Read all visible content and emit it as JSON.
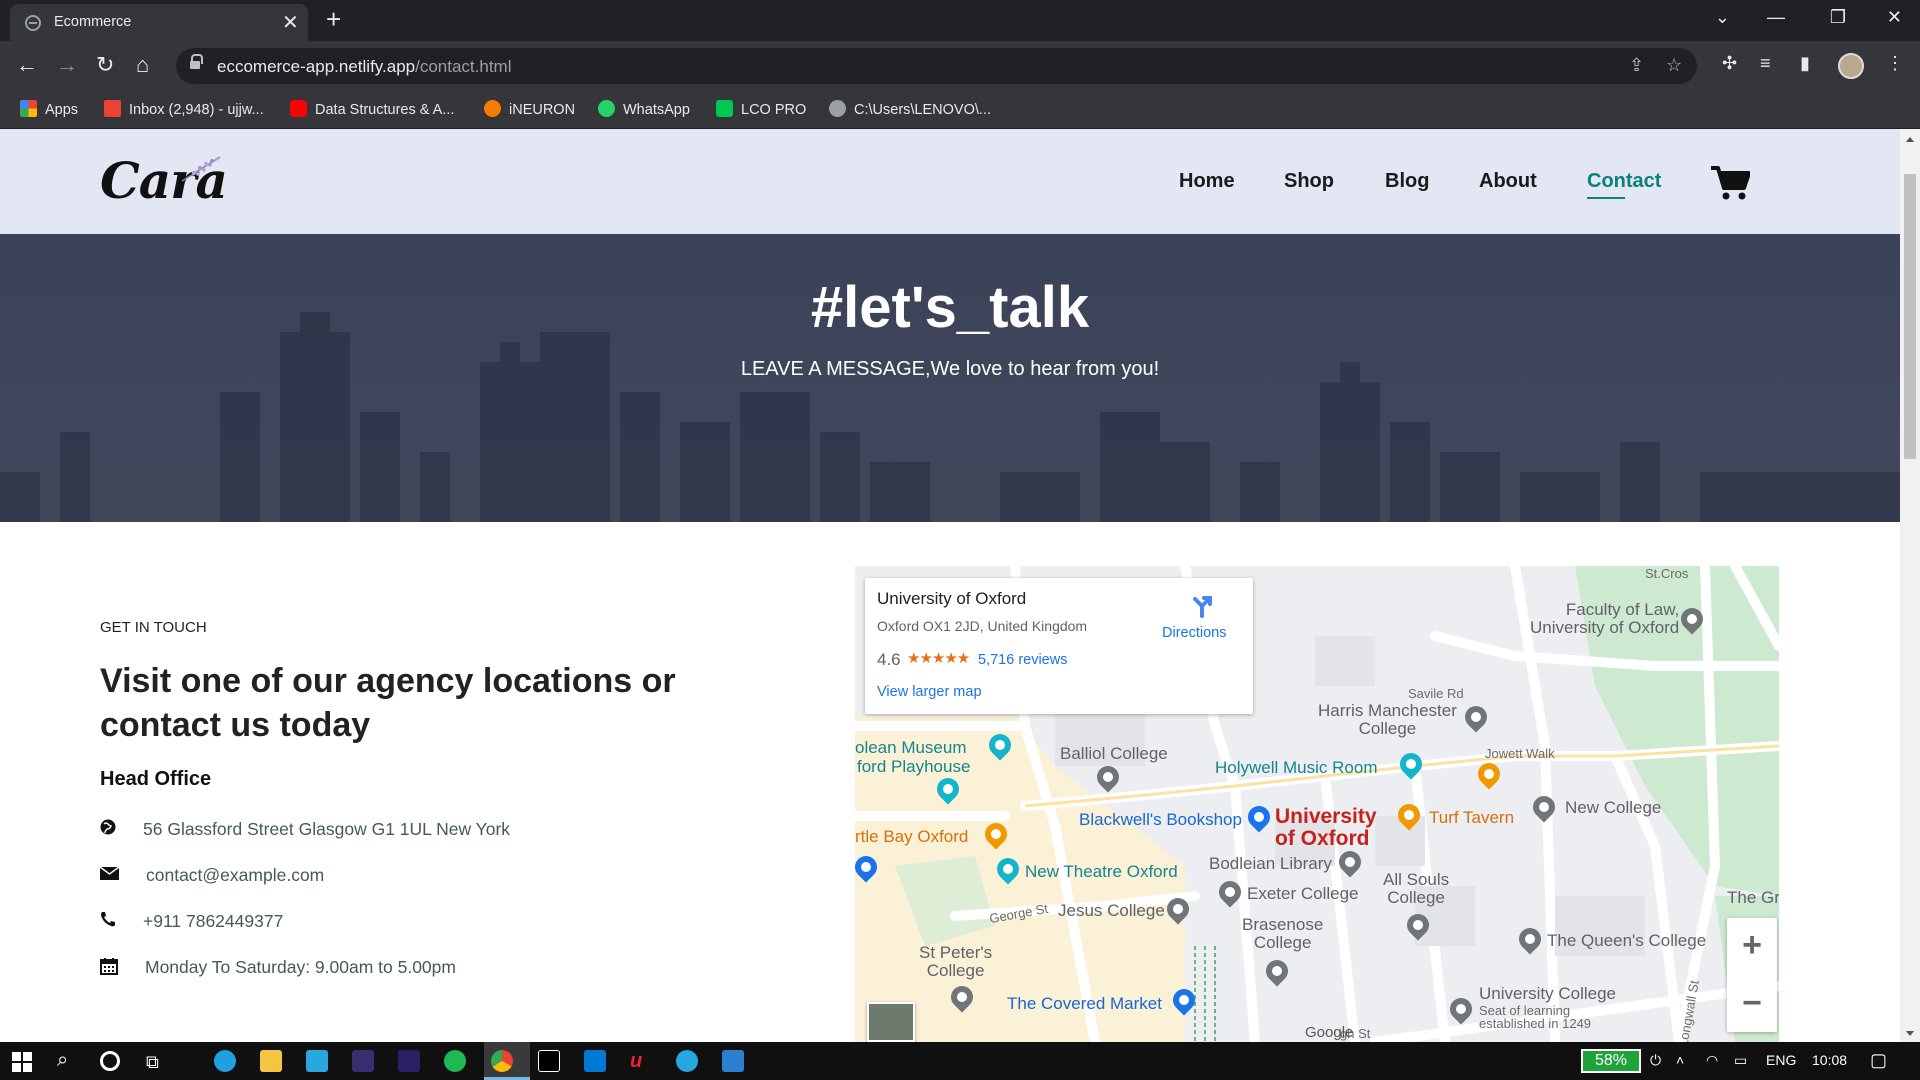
{
  "browser": {
    "tab_title": "Ecommerce",
    "url_host": "eccomerce-app.netlify.app",
    "url_path": "/contact.html",
    "bookmarks": [
      {
        "label": "Apps",
        "icon": "apps-grid-icon",
        "color": "#ea4335"
      },
      {
        "label": "Inbox (2,948) - ujjw...",
        "icon": "gmail-icon",
        "color": "#ea4335"
      },
      {
        "label": "Data Structures & A...",
        "icon": "youtube-icon",
        "color": "#ff0000"
      },
      {
        "label": "iNEURON",
        "icon": "ineuron-icon",
        "color": "#f57c00"
      },
      {
        "label": "WhatsApp",
        "icon": "whatsapp-icon",
        "color": "#25d366"
      },
      {
        "label": "LCO PRO",
        "icon": "lco-icon",
        "color": "#00c853"
      },
      {
        "label": "C:\\Users\\LENOVO\\...",
        "icon": "globe-icon",
        "color": "#9aa0a6"
      }
    ]
  },
  "site": {
    "logo": "Cara",
    "nav": [
      {
        "label": "Home"
      },
      {
        "label": "Shop"
      },
      {
        "label": "Blog"
      },
      {
        "label": "About"
      },
      {
        "label": "Contact",
        "active": true
      }
    ],
    "accent_color": "#088178",
    "header_bg": "#e3e6f3"
  },
  "hero": {
    "title": "#let's_talk",
    "subtitle": "LEAVE A MESSAGE,We love to hear from you!"
  },
  "contact": {
    "eyebrow": "GET IN TOUCH",
    "heading": "Visit one of our agency locations or contact us today",
    "office_heading": "Head Office",
    "items": [
      {
        "icon": "globe-icon",
        "text": "56 Glassford Street Glasgow G1 1UL New York"
      },
      {
        "icon": "envelope-icon",
        "text": "contact@example.com"
      },
      {
        "icon": "phone-icon",
        "text": "+911 7862449377"
      },
      {
        "icon": "calendar-icon",
        "text": "Monday To Saturday: 9.00am to 5.00pm"
      }
    ]
  },
  "map": {
    "card": {
      "title": "University of Oxford",
      "address": "Oxford OX1 2JD, United Kingdom",
      "rating": "4.6",
      "stars": "★★★★★",
      "reviews": "5,716 reviews",
      "larger_map": "View larger map",
      "directions": "Directions"
    },
    "labels": {
      "faculty_law": "Faculty of Law,\nUniversity of Oxford",
      "savile_rd": "Savile Rd",
      "harris": "Harris Manchester\nCollege",
      "jowett": "Jowett Walk",
      "ashmolean": "olean Museum",
      "playhouse": "ford Playhouse",
      "balliol": "Balliol College",
      "holywell": "Holywell Music Room",
      "blackwells": "Blackwell's Bookshop",
      "university": "University\nof Oxford",
      "turf": "Turf Tavern",
      "new_college": "New College",
      "turtle_bay": "rtle Bay Oxford",
      "new_theatre": "New Theatre Oxford",
      "bodleian": "Bodleian Library",
      "exeter": "Exeter College",
      "all_souls": "All Souls\nCollege",
      "george_st": "George St",
      "jesus": "Jesus College",
      "brasenose": "Brasenose\nCollege",
      "grove": "The Grov",
      "st_peters": "St Peter's\nCollege",
      "queens": "The Queen's College",
      "covered_market": "The Covered Market",
      "univ_college": "University College",
      "univ_college_sub": "Seat of learning\nestablished in 1249",
      "longwall": "Longwall St",
      "st_cross": "St.Cros",
      "high_st": "gh St",
      "google": "Google"
    },
    "zoom_in": "+",
    "zoom_out": "−"
  },
  "taskbar": {
    "battery": "58%",
    "lang": "ENG",
    "time": "10:08"
  }
}
